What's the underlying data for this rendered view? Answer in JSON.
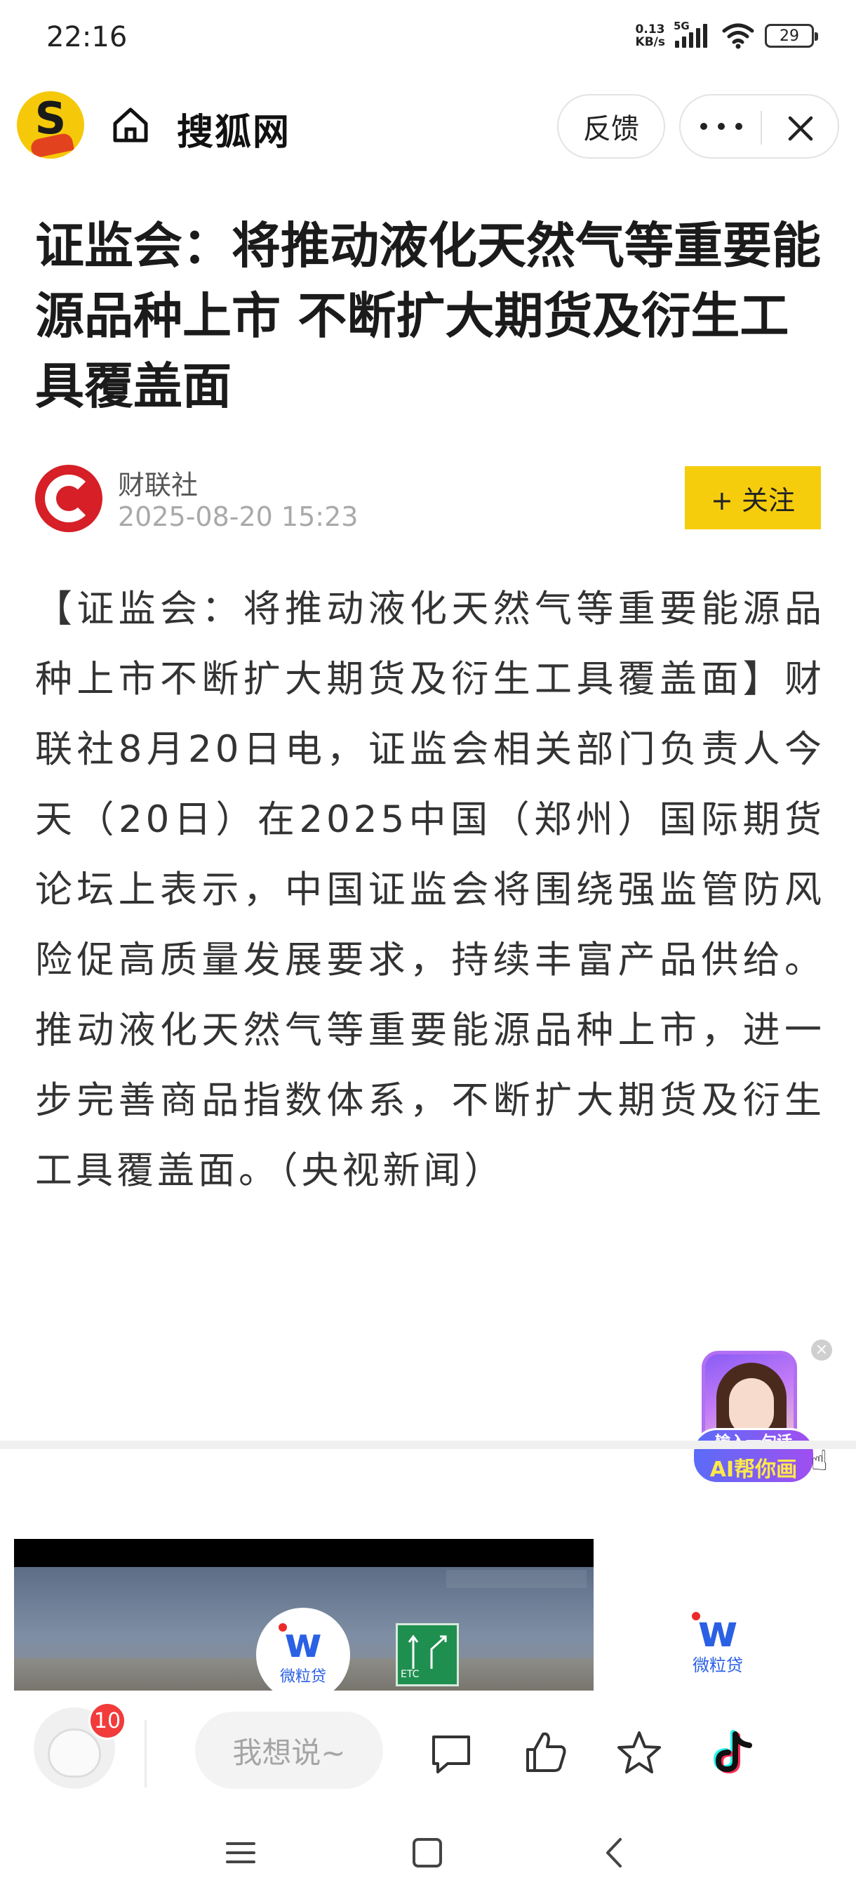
{
  "status_bar": {
    "time": "22:16",
    "net_speed_value": "0.13",
    "net_speed_unit": "KB/s",
    "network": "5G",
    "battery": "29"
  },
  "header": {
    "site_name": "搜狐网",
    "feedback_label": "反馈"
  },
  "article": {
    "title": "证监会：将推动液化天然气等重要能源品种上市 不断扩大期货及衍生工具覆盖面",
    "author": "财联社",
    "date": "2025-08-20 15:23",
    "follow_label": "+ 关注",
    "body": "【证监会：将推动液化天然气等重要能源品种上市不断扩大期货及衍生工具覆盖面】财联社8月20日电，证监会相关部门负责人今天（20日）在2025中国（郑州）国际期货论坛上表示，中国证监会将围绕强监管防风险促高质量发展要求，持续丰富产品供给。推动液化天然气等重要能源品种上市，进一步完善商品指数体系，不断扩大期货及衍生工具覆盖面。（央视新闻）"
  },
  "ai_widget": {
    "line1": "输入一句话",
    "line2": "AI帮你画"
  },
  "ad": {
    "brand": "微粒贷",
    "sign_text": "ETC"
  },
  "bottom_bar": {
    "badge_count": "10",
    "comment_placeholder": "我想说~"
  },
  "colors": {
    "follow_bg": "#f6cd0d",
    "logo_bg": "#f5c90a",
    "author_avatar": "#d61f26",
    "badge": "#f23b3b",
    "brand_blue": "#2a60e4"
  }
}
